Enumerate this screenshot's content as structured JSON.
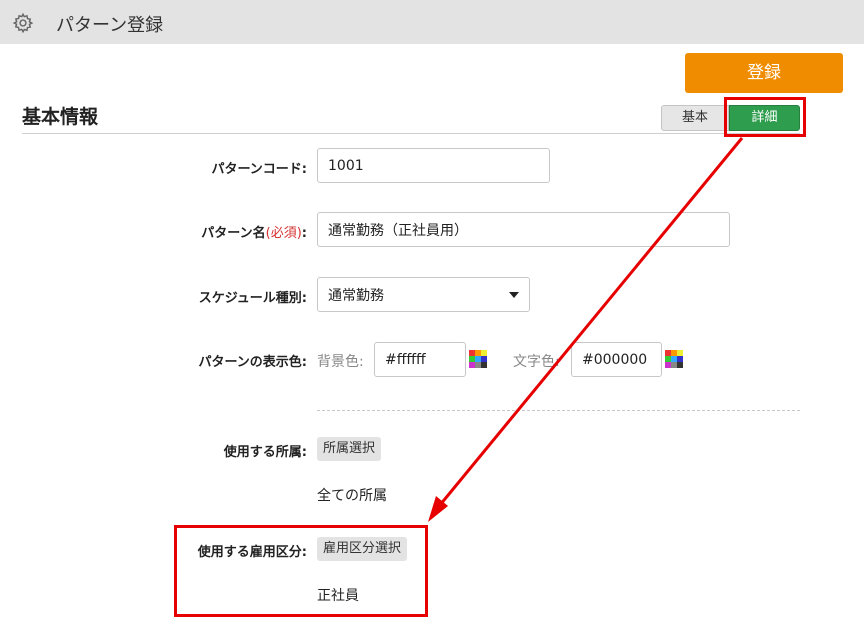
{
  "header": {
    "title": "パターン登録",
    "icon": "gear-icon"
  },
  "actions": {
    "register_label": "登録",
    "register_color": "#f08c00"
  },
  "section": {
    "title": "基本情報"
  },
  "tabs": {
    "basic": "基本",
    "detail": "詳細",
    "active_color": "#2e9e4e"
  },
  "form": {
    "code": {
      "label": "パターンコード:",
      "value": "1001"
    },
    "name": {
      "label": "パターン名",
      "required": "(必須)",
      "colon": ":",
      "value": "通常勤務（正社員用）"
    },
    "schedule_type": {
      "label": "スケジュール種別:",
      "value": "通常勤務"
    },
    "display_color": {
      "label": "パターンの表示色:",
      "bg_label": "背景色:",
      "bg_value": "#ffffff",
      "text_label": "文字色:",
      "text_value": "#000000"
    },
    "department": {
      "label": "使用する所属:",
      "button": "所属選択",
      "value": "全ての所属"
    },
    "employment": {
      "label": "使用する雇用区分:",
      "button": "雇用区分選択",
      "value": "正社員"
    }
  },
  "annotation": {
    "highlight_color": "#e60000"
  }
}
